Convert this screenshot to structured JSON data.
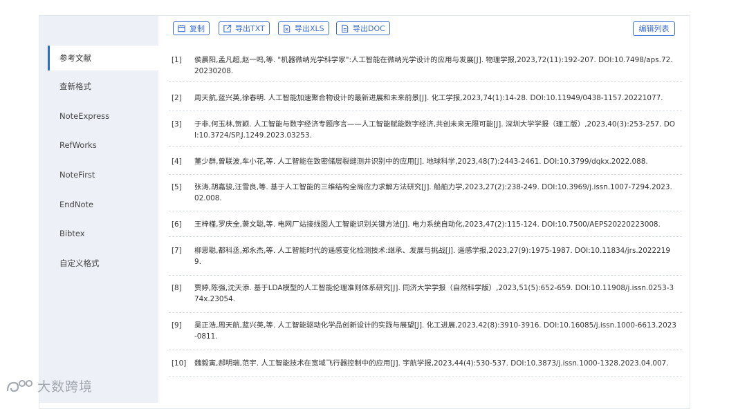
{
  "toolbar": {
    "copy": "复制",
    "export_txt": "导出TXT",
    "export_xls": "导出XLS",
    "export_doc": "导出DOC",
    "edit_list": "编辑列表"
  },
  "sidebar": {
    "items": [
      {
        "label": "参考文献",
        "active": true
      },
      {
        "label": "查新格式"
      },
      {
        "label": "NoteExpress"
      },
      {
        "label": "RefWorks"
      },
      {
        "label": "NoteFirst"
      },
      {
        "label": "EndNote"
      },
      {
        "label": "Bibtex"
      },
      {
        "label": "自定义格式"
      }
    ]
  },
  "references": [
    {
      "num": "[1]",
      "text": "侯晨阳,孟凡超,赵一鸣,等. \"机器微纳光学科学家\":人工智能在微纳光学设计的应用与发展[J]. 物理学报,2023,72(11):192-207. DOI:10.7498/aps.72.20230208."
    },
    {
      "num": "[2]",
      "text": "周天航,蓝兴英,徐春明. 人工智能加速聚合物设计的最新进展和未来前景[J]. 化工学报,2023,74(1):14-28. DOI:10.11949/0438-1157.20221077."
    },
    {
      "num": "[3]",
      "text": "于非,何玉林,贺颖. 人工智能与数字经济专题序言——人工智能赋能数字经济,共创未来无限可能[J]. 深圳大学学报（理工版）,2023,40(3):253-257. DOI:10.3724/SP.J.1249.2023.03253."
    },
    {
      "num": "[4]",
      "text": "董少群,曾联波,车小花,等. 人工智能在致密储层裂缝测井识别中的应用[J]. 地球科学,2023,48(7):2443-2461. DOI:10.3799/dqkx.2022.088."
    },
    {
      "num": "[5]",
      "text": "张涛,胡嘉骏,汪雪良,等. 基于人工智能的三维结构全局应力求解方法研究[J]. 船舶力学,2023,27(2):238-249. DOI:10.3969/j.issn.1007-7294.2023.02.008."
    },
    {
      "num": "[6]",
      "text": "王梓槿,罗庆全,萧文聪,等. 电网厂站接线图人工智能识别关键方法[J]. 电力系统自动化,2023,47(2):115-124. DOI:10.7500/AEPS20220223008."
    },
    {
      "num": "[7]",
      "text": "柳思聪,都科丞,郑永杰,等. 人工智能时代的遥感变化检测技术:继承、发展与挑战[J]. 遥感学报,2023,27(9):1975-1987. DOI:10.11834/jrs.20222199."
    },
    {
      "num": "[8]",
      "text": "贾婷,陈强,沈天添. 基于LDA模型的人工智能伦理准则体系研究[J]. 同济大学学报（自然科学版）,2023,51(5):652-659. DOI:10.11908/j.issn.0253-374x.23054."
    },
    {
      "num": "[9]",
      "text": "吴正浩,周天航,蓝兴英,等. 人工智能驱动化学品创新设计的实践与展望[J]. 化工进展,2023,42(8):3910-3916. DOI:10.16085/j.issn.1000-6613.2023-0811."
    },
    {
      "num": "[10]",
      "text": "魏毅寅,郝明瑞,范宇. 人工智能技术在宽域飞行器控制中的应用[J]. 宇航学报,2023,44(4):530-537. DOI:10.3873/j.issn.1000-1328.2023.04.007."
    }
  ],
  "watermark": "大数跨境",
  "colors": {
    "accent": "#3a6fcf",
    "sidebar_bg": "#edf1f7"
  }
}
